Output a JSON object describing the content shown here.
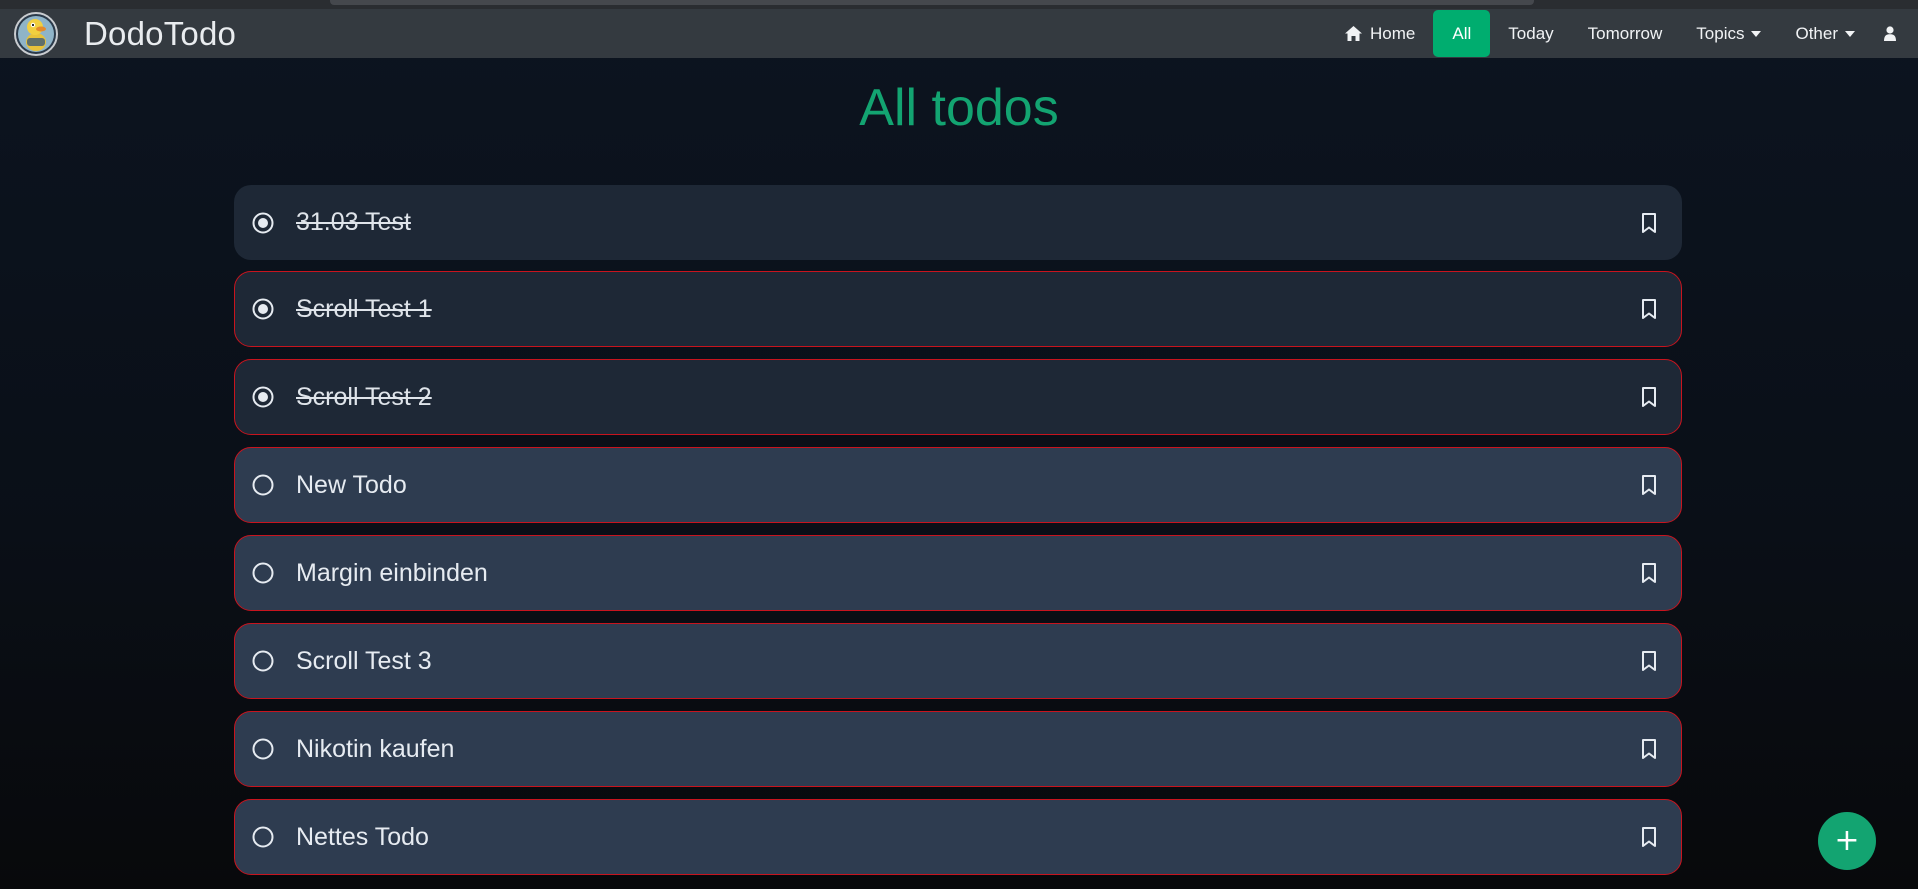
{
  "brand": {
    "name": "DodoTodo",
    "logo_icon": "duck-mascot-icon"
  },
  "nav": {
    "home_label": "Home",
    "all_label": "All",
    "today_label": "Today",
    "tomorrow_label": "Tomorrow",
    "topics_label": "Topics",
    "other_label": "Other",
    "user_icon": "user-icon"
  },
  "page": {
    "title": "All todos"
  },
  "todos": [
    {
      "label": "31.03 Test",
      "done": true,
      "overdue": false
    },
    {
      "label": "Scroll Test 1",
      "done": true,
      "overdue": true
    },
    {
      "label": "Scroll Test 2",
      "done": true,
      "overdue": true
    },
    {
      "label": "New Todo",
      "done": false,
      "overdue": true
    },
    {
      "label": "Margin einbinden",
      "done": false,
      "overdue": true
    },
    {
      "label": "Scroll Test 3",
      "done": false,
      "overdue": true
    },
    {
      "label": "Nikotin kaufen",
      "done": false,
      "overdue": true
    },
    {
      "label": "Nettes Todo",
      "done": false,
      "overdue": true
    }
  ],
  "fab": {
    "label": "+"
  },
  "colors": {
    "accent": "#13a471",
    "overdue_border": "#c8141e",
    "done_bg": "#1e2836",
    "open_bg": "#2e3c50"
  }
}
